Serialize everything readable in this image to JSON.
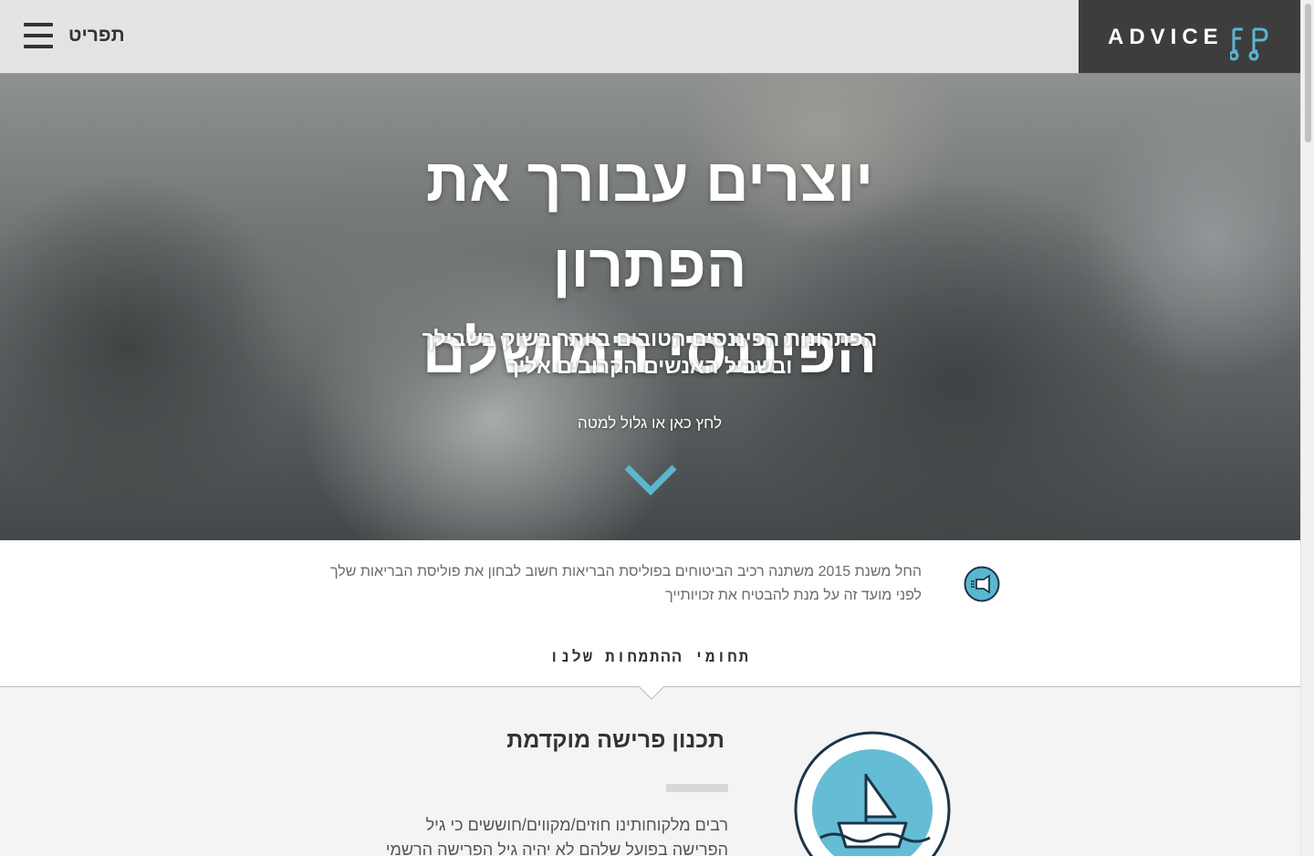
{
  "header": {
    "menu_label": "תפריט",
    "logo_text": "ADVICE",
    "logo_letters": "FP",
    "logo_bg": "#3d3d3d",
    "accent": "#5bb6cf"
  },
  "hero": {
    "title_line1": "יוצרים עבורך את הפתרון",
    "title_line2": "הפיננסי המושלם",
    "subtitle_line1": "הפתרונות הפיננסים הטובים ביותר בשוק בשבילך",
    "subtitle_line2": "ובשביל האנשים הקרובים אליך",
    "cta": "לחץ כאן או גלול למטה",
    "chevron_icon": "chevron-down-icon"
  },
  "notice": {
    "line1": "החל משנת 2015 משתנה רכיב הביטוחים בפוליסת הבריאות חשוב לבחון את פוליסת הבריאות שלך",
    "line2": "לפני מועד זה על מנת להבטיח את זכויותייך",
    "icon": "megaphone-icon"
  },
  "section": {
    "title": "תחומי ההתמחות שלנו"
  },
  "feature": {
    "title": "תכנון פרישה מוקדמת",
    "text_line1": "רבים מלקוחותינו חוזים/מקווים/חוששים כי גיל",
    "text_line2": "הפרישה בפועל שלהם לא יהיה גיל הפרישה הרשמי",
    "icon": "sailboat-icon"
  }
}
